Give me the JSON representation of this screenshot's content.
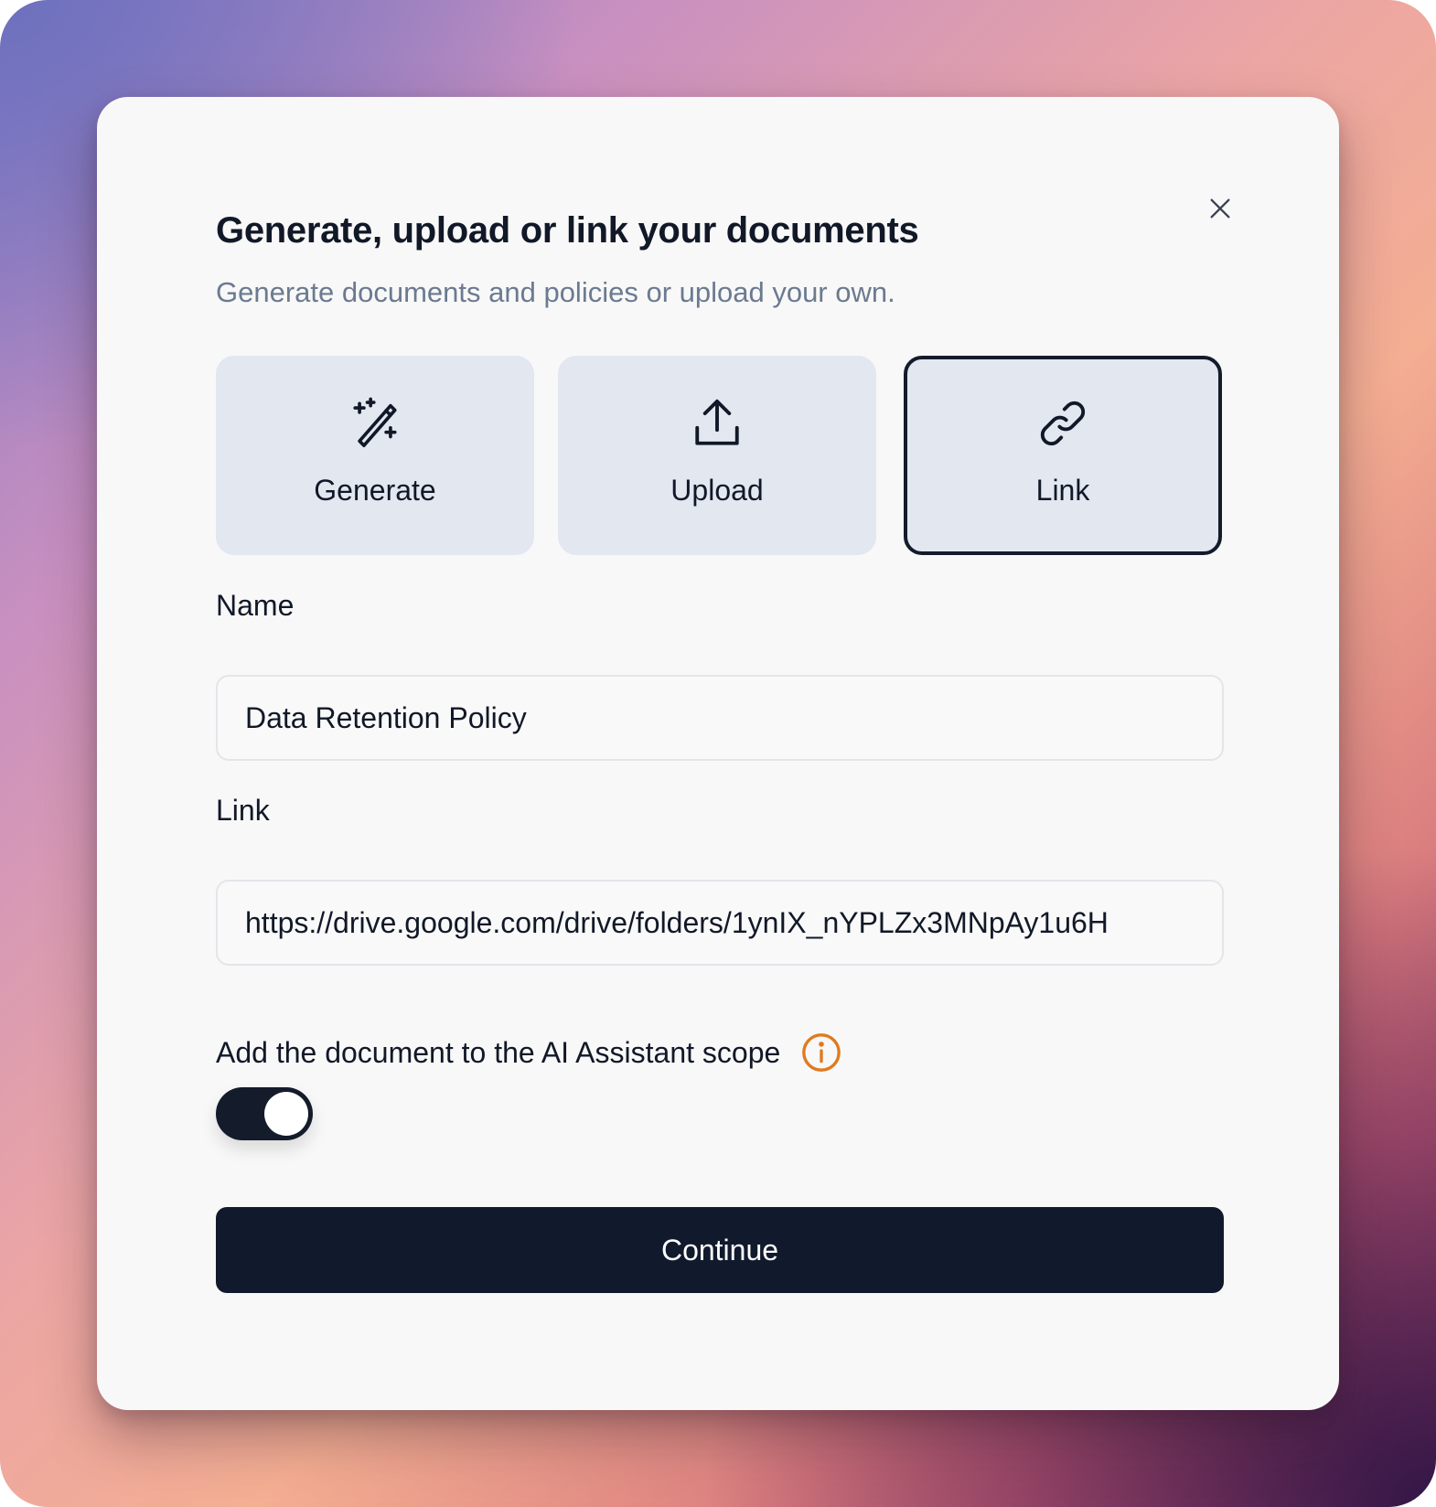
{
  "dialog": {
    "title": "Generate, upload or link your documents",
    "subtitle": "Generate documents and policies or upload your own.",
    "close_icon": "close-icon"
  },
  "options": [
    {
      "label": "Generate",
      "icon": "magic-wand-icon",
      "selected": false
    },
    {
      "label": "Upload",
      "icon": "upload-icon",
      "selected": false
    },
    {
      "label": "Link",
      "icon": "link-icon",
      "selected": true
    }
  ],
  "form": {
    "name_label": "Name",
    "name_value": "Data Retention Policy",
    "link_label": "Link",
    "link_value": "https://drive.google.com/drive/folders/1ynIX_nYPLZx3MNpAy1u6H",
    "scope_label": "Add the document to the AI Assistant scope",
    "scope_enabled": true,
    "info_icon": "info-icon"
  },
  "actions": {
    "continue_label": "Continue"
  },
  "colors": {
    "primary": "#111a2c",
    "card": "#e2e7f0",
    "info_accent": "#e07a1f",
    "subtitle": "#6b7a90"
  }
}
